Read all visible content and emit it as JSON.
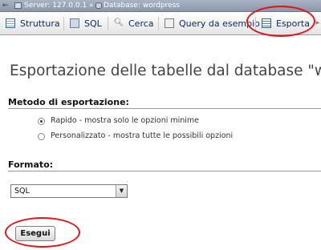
{
  "breadcrumb": {
    "server": "Server: 127.0.0.1 »",
    "database": "Database: wordpress"
  },
  "tabs": [
    {
      "label": "Struttura",
      "icon": "structure-icon"
    },
    {
      "label": "SQL",
      "icon": "sql-icon"
    },
    {
      "label": "Cerca",
      "icon": "search-icon"
    },
    {
      "label": "Query da esempio",
      "icon": "query-icon"
    },
    {
      "label": "Esporta",
      "icon": "export-icon",
      "active": true
    }
  ],
  "page": {
    "title": "Esportazione delle tabelle dal database \"word"
  },
  "export_method": {
    "legend": "Metodo di esportazione:",
    "options": [
      {
        "label": "Rapido - mostra solo le opzioni minime",
        "checked": true
      },
      {
        "label": "Personalizzato - mostra tutte le possibili opzioni",
        "checked": false
      }
    ]
  },
  "format": {
    "legend": "Formato:",
    "selected": "SQL"
  },
  "submit": {
    "label": "Esegui"
  },
  "colors": {
    "highlight": "#e0141a",
    "link": "#0a2a6a"
  }
}
